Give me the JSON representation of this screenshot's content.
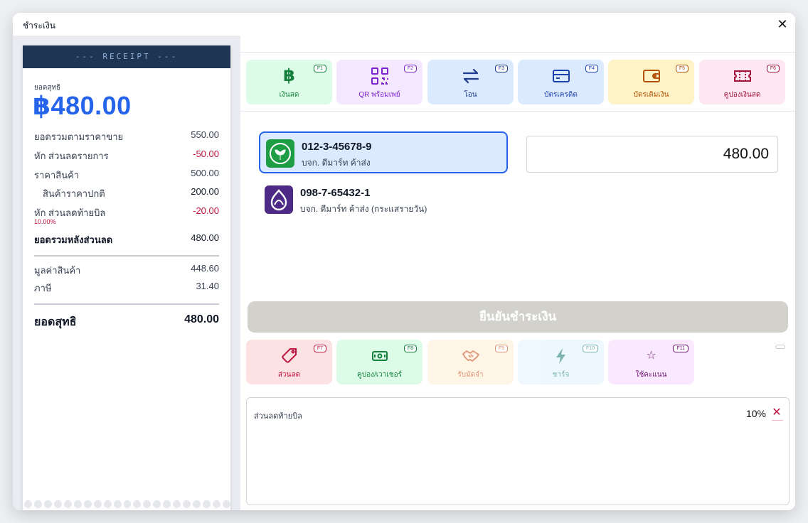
{
  "modal": {
    "title": "ชำระเงิน",
    "close": "✕"
  },
  "receipt": {
    "header": "--- RECEIPT ---",
    "net_label": "ยอดสุทธิ",
    "net_amount": "฿480.00",
    "lines": [
      {
        "label": "ยอดรวมตามราคาขาย",
        "value": "550.00"
      },
      {
        "label": "หัก ส่วนลดรายการ",
        "value": "-50.00"
      },
      {
        "label": "ราคาสินค้า",
        "value": "500.00"
      },
      {
        "label": "สินค้าราคาปกติ",
        "value": "200.00"
      },
      {
        "label": "หัก ส่วนลดท้ายบิล",
        "value": "-20.00",
        "note": "10.00%"
      },
      {
        "label": "ยอดรวมหลังส่วนลด",
        "value": "480.00"
      },
      {
        "label": "มูลค่าสินค้า",
        "value": "448.60"
      },
      {
        "label": "ภาษี",
        "value": "31.40"
      },
      {
        "label": "ยอดสุทธิ",
        "value": "480.00"
      }
    ]
  },
  "payment_methods": [
    {
      "label": "เงินสด",
      "key": "F1",
      "icon": "baht-icon",
      "color": "#15803d",
      "bg": "#dcfce7"
    },
    {
      "label": "QR พร้อมเพย์",
      "key": "F2",
      "icon": "qr-icon",
      "color": "#7e22ce",
      "bg": "#f3e8ff"
    },
    {
      "label": "โอน",
      "key": "F3",
      "icon": "transfer-icon",
      "color": "#1e3a8a",
      "bg": "#dbeafe"
    },
    {
      "label": "บัตรเครดิต",
      "key": "F4",
      "icon": "credit-card-icon",
      "color": "#1e40af",
      "bg": "#dbeafe"
    },
    {
      "label": "บัตรเติมเงิน",
      "key": "F5",
      "icon": "wallet-icon",
      "color": "#b45309",
      "bg": "#fef3c7"
    },
    {
      "label": "คูปองเงินสด",
      "key": "F6",
      "icon": "ticket-icon",
      "color": "#9f1239",
      "bg": "#fce7f3"
    }
  ],
  "accounts": [
    {
      "number": "012-3-45678-9",
      "owner": "บจก. ดีมาร์ท ค้าส่ง",
      "logo_color": "#1f9d45",
      "selected": true
    },
    {
      "number": "098-7-65432-1",
      "owner": "บจก. ดีมาร์ท ค้าส่ง (กระแสรายวัน)",
      "logo_color": "#4c2a85",
      "selected": false
    }
  ],
  "amount_input": {
    "value": "480.00"
  },
  "confirm_button": "ยืนยันชำระเงิน",
  "extra_actions": [
    {
      "label": "ส่วนลด",
      "key": "F7",
      "icon": "tag-icon",
      "color": "#be123c",
      "bg": "#fde2e4",
      "enabled": true
    },
    {
      "label": "คูปอง/เวาเชอร์",
      "key": "F8",
      "icon": "voucher-icon",
      "color": "#15803d",
      "bg": "#dcfce7",
      "enabled": true
    },
    {
      "label": "รับมัดจำ",
      "key": "F9",
      "icon": "handshake-icon",
      "color": "#c2410c",
      "bg": "#ffedd5",
      "enabled": false
    },
    {
      "label": "ชาร์จ",
      "key": "F10",
      "icon": "bolt-icon",
      "color": "#0f766e",
      "bg": "#e0f2fe",
      "enabled": false
    },
    {
      "label": "ใช้คะแนน",
      "key": "F11",
      "icon": "star-icon",
      "color": "#701a75",
      "bg": "#fae8ff",
      "enabled": true
    }
  ],
  "discount_panel": {
    "title": "ส่วนลดท้ายบิล",
    "percent": "10%",
    "remove": "✕"
  }
}
